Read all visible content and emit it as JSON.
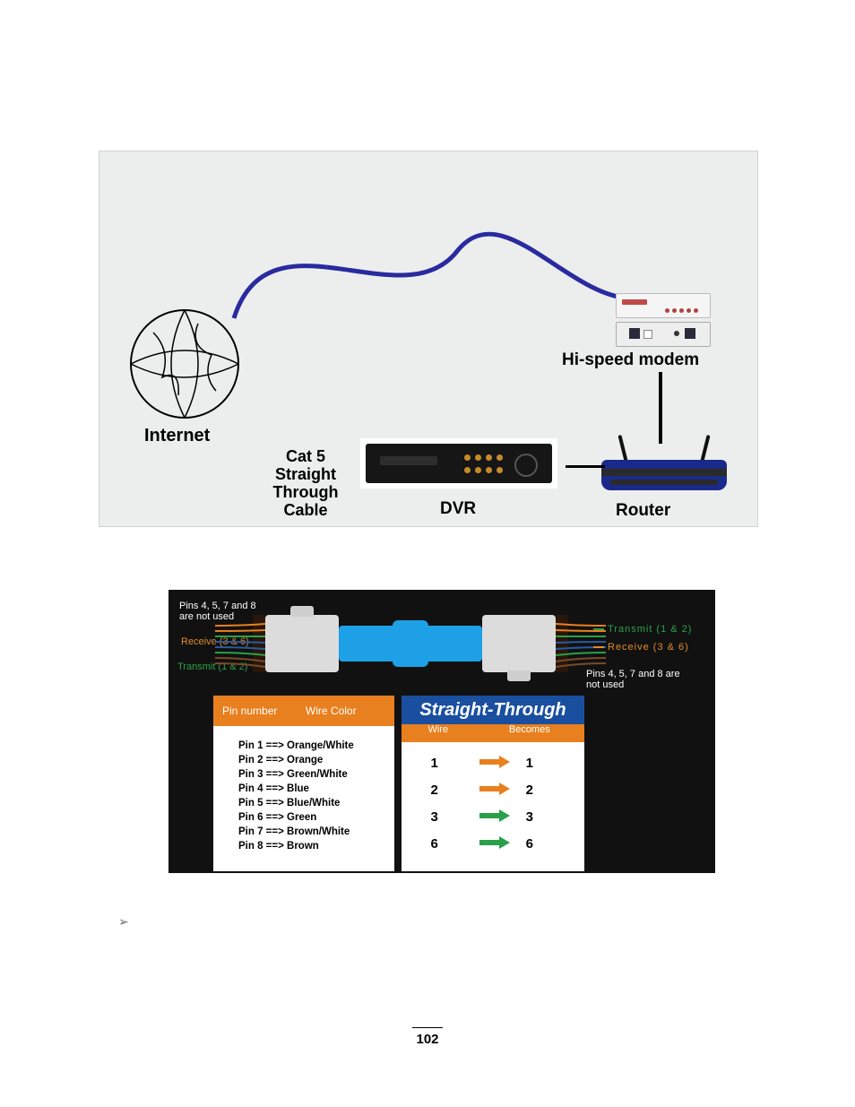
{
  "page_number": "102",
  "fig1": {
    "internet": "Internet",
    "cat5_line1": "Cat 5",
    "cat5_line2": "Straight Through",
    "cat5_line3": "Cable",
    "dvr": "DVR",
    "router": "Router",
    "modem": "Hi-speed modem"
  },
  "fig2": {
    "top_left_note": "Pins 4, 5, 7 and 8 are not used",
    "top_left_receive": "Receive (3 & 6)",
    "top_left_transmit": "Transmit (1 & 2)",
    "top_right_transmit": "Transmit (1 & 2)",
    "top_right_receive": "Receive (3 & 6)",
    "top_right_note": "Pins 4, 5, 7 and 8 are not used",
    "pin_header_col1": "Pin number",
    "pin_header_col2": "Wire Color",
    "pin_rows": [
      "Pin 1 ==> Orange/White",
      "Pin 2 ==> Orange",
      "Pin 3 ==> Green/White",
      "Pin 4 ==> Blue",
      "Pin 5 ==> Blue/White",
      "Pin 6 ==> Green",
      "Pin 7 ==> Brown/White",
      "Pin 8 ==> Brown"
    ],
    "st_title": "Straight-Through",
    "st_col_wire": "Wire",
    "st_col_becomes": "Becomes",
    "st_rows": [
      {
        "a": "1",
        "b": "1",
        "color": "o"
      },
      {
        "a": "2",
        "b": "2",
        "color": "o"
      },
      {
        "a": "3",
        "b": "3",
        "color": "g"
      },
      {
        "a": "6",
        "b": "6",
        "color": "g"
      }
    ]
  },
  "bullet_glyph": "➢"
}
